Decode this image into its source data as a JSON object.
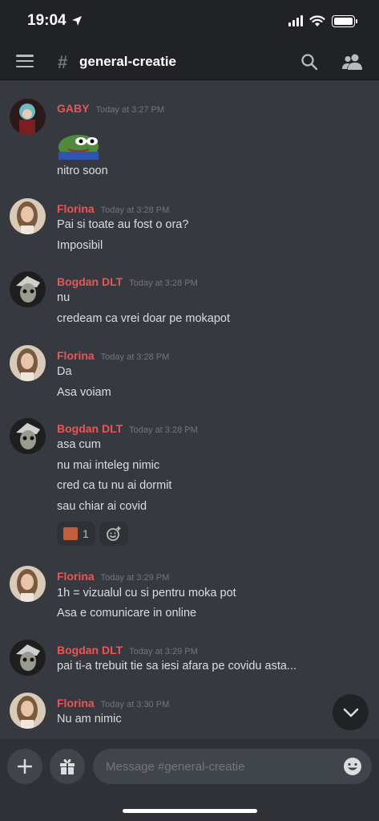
{
  "status_bar": {
    "time": "19:04"
  },
  "header": {
    "channel_name": "general-creatie"
  },
  "messages": [
    {
      "user": "GABY",
      "time": "Today at 3:27 PM",
      "avatar": "anime-avatar",
      "lines": [
        "nitro soon"
      ],
      "sticker": "pepe-emoji"
    },
    {
      "user": "Florina",
      "time": "Today at 3:28 PM",
      "avatar": "woman-avatar",
      "lines": [
        "Pai si toate au fost o ora?",
        "Imposibil"
      ]
    },
    {
      "user": "Bogdan DLT",
      "time": "Today at 3:28 PM",
      "avatar": "skull-avatar",
      "lines": [
        "nu",
        "credeam ca vrei doar pe mokapot"
      ]
    },
    {
      "user": "Florina",
      "time": "Today at 3:28 PM",
      "avatar": "woman-avatar",
      "lines": [
        "Da",
        "Asa voiam"
      ]
    },
    {
      "user": "Bogdan DLT",
      "time": "Today at 3:28 PM",
      "avatar": "skull-avatar",
      "lines": [
        "asa cum",
        "nu mai inteleg nimic",
        "cred ca tu nu ai dormit",
        "sau chiar ai covid"
      ],
      "reaction": {
        "count": "1",
        "icon": "custom-emoji"
      }
    },
    {
      "user": "Florina",
      "time": "Today at 3:29 PM",
      "avatar": "woman-avatar",
      "lines": [
        "1h = vizualul cu si pentru moka pot",
        "Asa e comunicare in online"
      ]
    },
    {
      "user": "Bogdan DLT",
      "time": "Today at 3:29 PM",
      "avatar": "skull-avatar",
      "lines": [
        "pai ti-a trebuit tie sa iesi afara pe covidu asta..."
      ]
    },
    {
      "user": "Florina",
      "time": "Today at 3:30 PM",
      "avatar": "woman-avatar",
      "lines": [
        "Nu am nimic"
      ]
    }
  ],
  "composer": {
    "placeholder": "Message #general-creatie"
  },
  "colors": {
    "background": "#36393f",
    "header": "#202225",
    "username": "#e85757",
    "text": "#dcddde",
    "muted": "#72767d"
  },
  "icons": [
    "menu-icon",
    "channel-hash-icon",
    "search-icon",
    "members-icon",
    "chevron-down-icon",
    "plus-icon",
    "gift-icon",
    "emoji-icon",
    "add-reaction-icon"
  ]
}
